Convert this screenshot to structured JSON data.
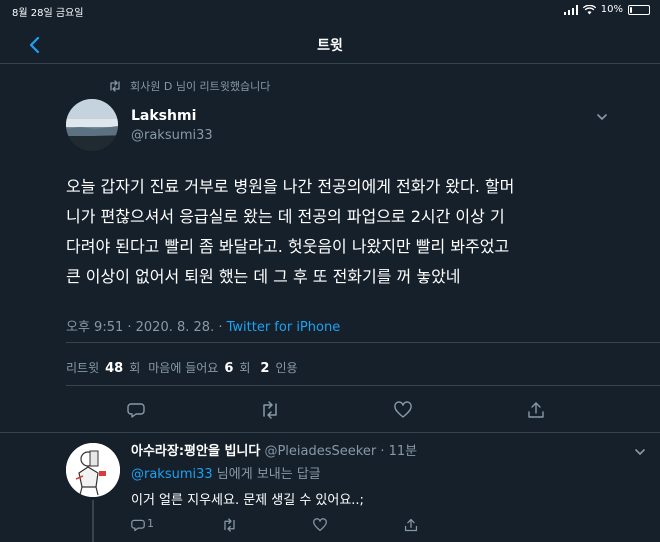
{
  "status_bar": {
    "time": "8월 28일 금요일",
    "battery": "10%",
    "battery_level": 0.1
  },
  "header": {
    "title": "트윗",
    "back_icon": "chevron-left-icon"
  },
  "retweet_context": "회사원 D 님이 리트윗했습니다",
  "tweet": {
    "display_name": "Lakshmi",
    "username": "@raksumi33",
    "text_lines": [
      "오늘 갑자기 진료 거부로 병원을 나간 전공의에게 전화가 왔다. 할머",
      "니가 편찮으셔서 응급실로 왔는 데 전공의 파업으로 2시간 이상 기",
      "다려야 된다고 빨리 좀 봐달라고. 헛웃음이 나왔지만 빨리 봐주었고",
      "큰 이상이 없어서 퇴원 했는 데 그 후 또 전화기를 꺼 놓았네"
    ],
    "timestamp": "오후 9:51 · 2020. 8. 28. · ",
    "source": "Twitter for iPhone",
    "stats": {
      "retweets_label": "리트윗",
      "retweets": "48",
      "retweets_unit": "회",
      "likes_label": "마음에 들어요",
      "likes": "6",
      "likes_unit": "회",
      "quotes": "2",
      "quotes_label": "인용"
    }
  },
  "reply": {
    "display_name": "아수라장:평안을 빕니다",
    "username": "@PleiadesSeeker",
    "time": " · 11분",
    "reply_to_user": "@raksumi33",
    "reply_to_suffix": " 님에게 보내는 답글",
    "text": "이거 얼른 지우세요. 문제 생길 수 있어요..;",
    "reply_count": "1"
  },
  "colors": {
    "background": "#15202b",
    "accent": "#1da1f2",
    "muted": "#8899a6",
    "divider": "#38444d"
  }
}
